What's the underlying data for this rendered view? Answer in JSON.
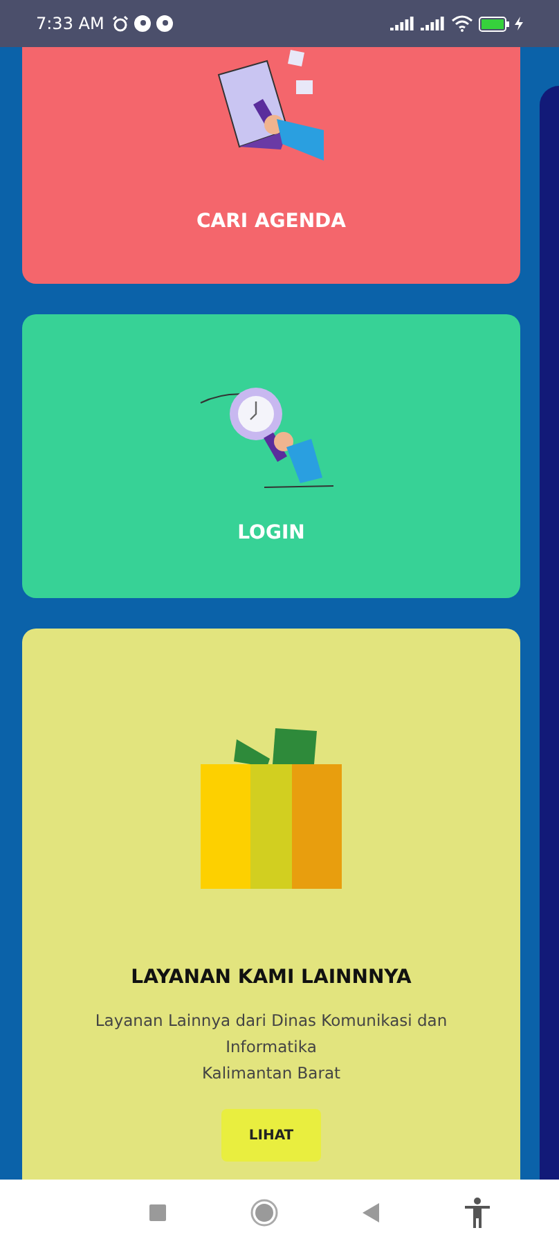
{
  "status_bar": {
    "time": "7:33 AM"
  },
  "cards": [
    {
      "kind": "agenda",
      "title": "CARI AGENDA",
      "color": "#f4666c"
    },
    {
      "kind": "login",
      "title": "LOGIN",
      "color": "#37d296"
    },
    {
      "kind": "services",
      "title": "LAYANAN KAMI LAINNNYA",
      "color": "#e2e47e",
      "description": "Layanan Lainnya dari Dinas Komunikasi dan Informatika\nKalimantan Barat",
      "button": "LIHAT"
    }
  ]
}
